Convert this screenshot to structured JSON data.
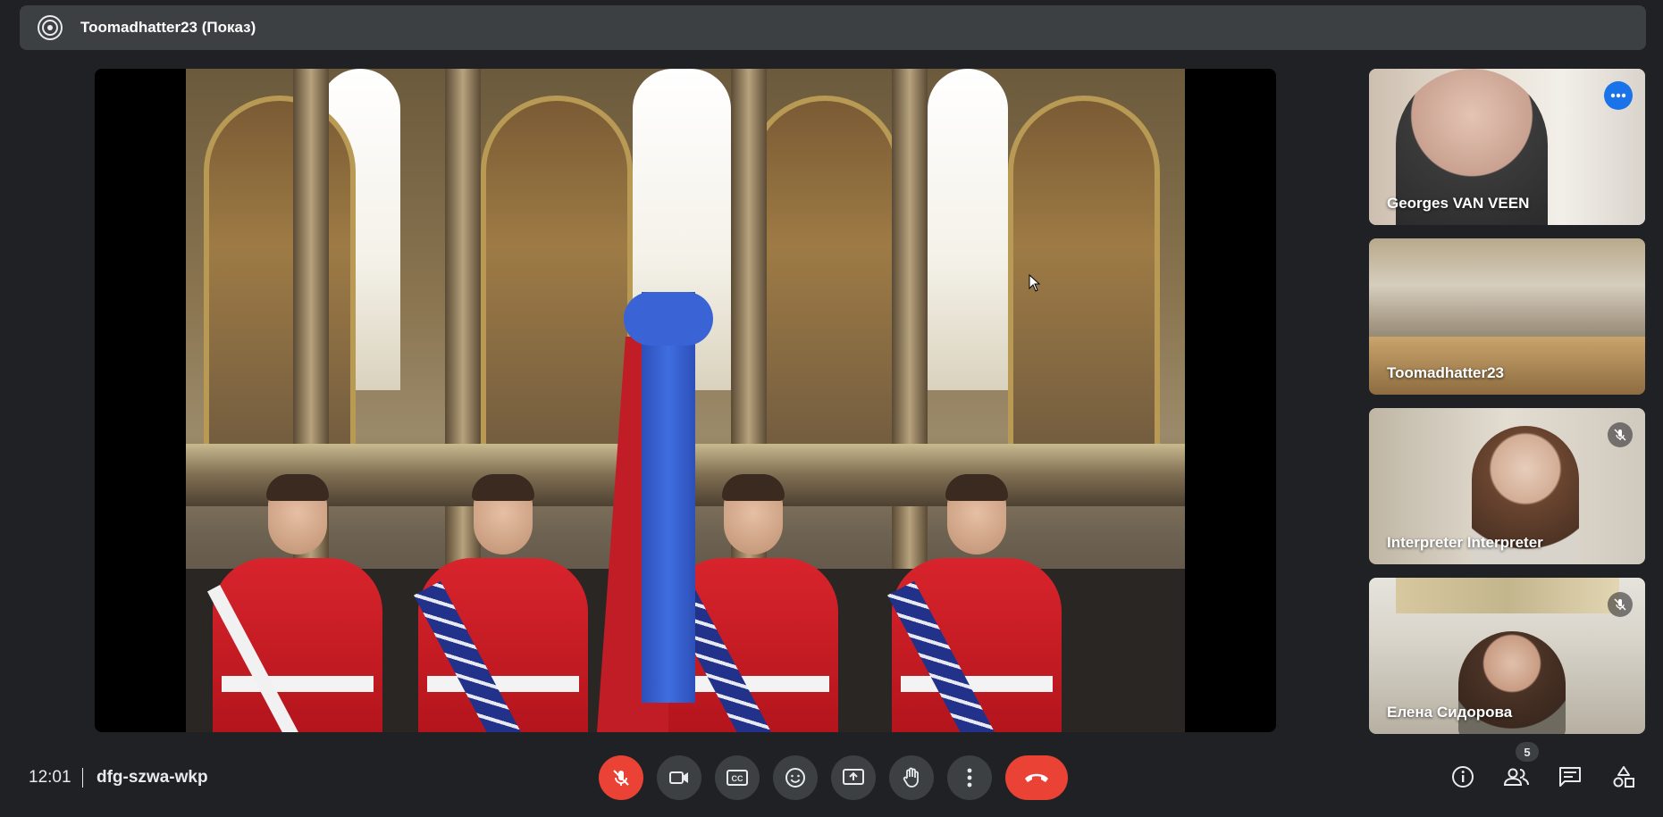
{
  "topbar": {
    "presenter_title": "Toomadhatter23 (Показ)"
  },
  "participants": [
    {
      "name": "Georges VAN VEEN",
      "active": true
    },
    {
      "name": "Toomadhatter23"
    },
    {
      "name": "Interpreter Interpreter",
      "muted": true
    },
    {
      "name": "Елена Сидорова",
      "muted": true
    }
  ],
  "bottombar": {
    "time": "12:01",
    "meeting_code": "dfg-szwa-wkp",
    "people_count": "5",
    "controls": [
      "microphone-off",
      "camera",
      "captions",
      "emoji",
      "present-screen",
      "raise-hand",
      "more-options",
      "leave-call"
    ],
    "right_controls": [
      "meeting-info",
      "people",
      "chat",
      "activities"
    ]
  },
  "colors": {
    "background": "#202124",
    "surface": "#3c4043",
    "danger": "#ea4335",
    "accent": "#8ab4f8",
    "accent_button": "#1a73e8"
  }
}
